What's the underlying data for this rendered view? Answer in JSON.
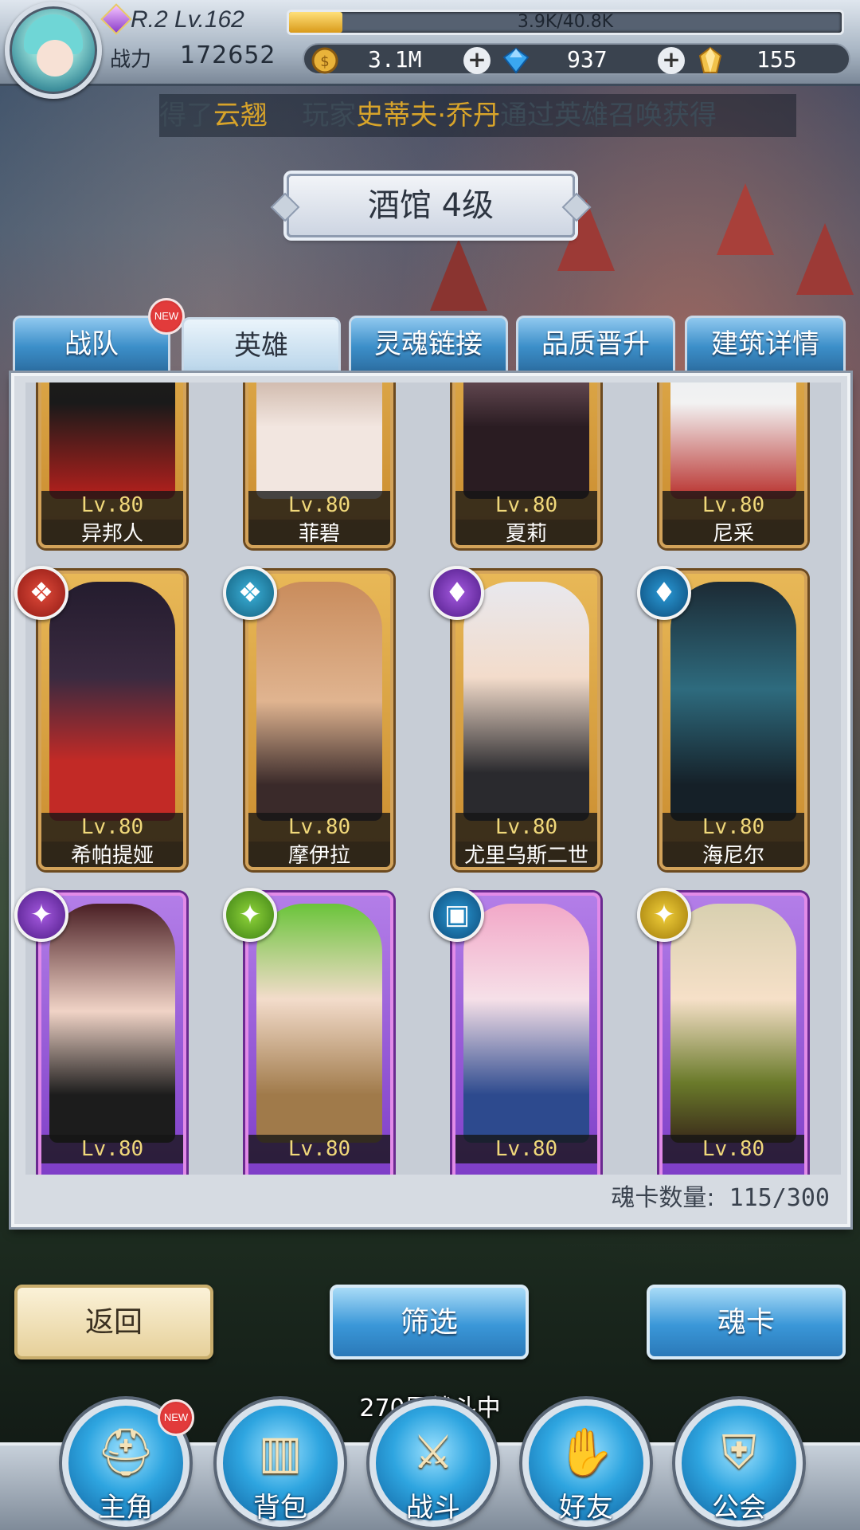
{
  "player": {
    "rank_level": "R.2 Lv.162",
    "exp_text": "3.9K/40.8K",
    "exp_fraction": 0.096,
    "power_label": "战力",
    "power_value": "172652"
  },
  "currencies": [
    {
      "icon": "gold-coin-icon",
      "value": "3.1M",
      "color": "#e9b33a"
    },
    {
      "icon": "blue-diamond-icon",
      "value": "937",
      "color": "#3aa7f0"
    },
    {
      "icon": "gold-crystal-icon",
      "value": "155",
      "color": "#f1c24a"
    }
  ],
  "marquee": {
    "part1": "得了",
    "part1_hl": "云翘",
    "part2": "玩家",
    "part2_hl": "史蒂夫·乔丹",
    "part3": "通过英雄召唤获得"
  },
  "title": "酒馆 4级",
  "tabs": [
    {
      "label": "战队",
      "active": false,
      "new": true
    },
    {
      "label": "英雄",
      "active": true,
      "new": false
    },
    {
      "label": "灵魂链接",
      "active": false,
      "new": false
    },
    {
      "label": "品质晋升",
      "active": false,
      "new": false
    },
    {
      "label": "建筑详情",
      "active": false,
      "new": false
    }
  ],
  "new_badge": "NEW",
  "heroes": [
    {
      "level": "Lv.80",
      "name": "异邦人",
      "frame": "gold"
    },
    {
      "level": "Lv.80",
      "name": "菲碧",
      "frame": "gold"
    },
    {
      "level": "Lv.80",
      "name": "夏莉",
      "frame": "gold"
    },
    {
      "level": "Lv.80",
      "name": "尼采",
      "frame": "gold"
    },
    {
      "level": "Lv.80",
      "name": "希帕提娅",
      "frame": "gold",
      "element": "red"
    },
    {
      "level": "Lv.80",
      "name": "摩伊拉",
      "frame": "gold",
      "element": "blue"
    },
    {
      "level": "Lv.80",
      "name": "尤里乌斯二世",
      "frame": "gold",
      "element": "purple"
    },
    {
      "level": "Lv.80",
      "name": "海尼尔",
      "frame": "gold",
      "element": "navy"
    },
    {
      "level": "Lv.80",
      "name": "",
      "frame": "purple",
      "element": "purple"
    },
    {
      "level": "Lv.80",
      "name": "",
      "frame": "purple",
      "element": "green"
    },
    {
      "level": "Lv.80",
      "name": "",
      "frame": "purple",
      "element": "navy"
    },
    {
      "level": "Lv.80",
      "name": "",
      "frame": "purple",
      "element": "gold"
    }
  ],
  "card_count": {
    "label": "魂卡数量:",
    "value": "115/300"
  },
  "buttons": {
    "back": "返回",
    "filter": "筛选",
    "soul_card": "魂卡"
  },
  "battle_status": "270层战斗中",
  "nav": [
    {
      "label": "主角",
      "icon": "knight-helmet-icon",
      "new": true
    },
    {
      "label": "背包",
      "icon": "backpack-icon",
      "new": false
    },
    {
      "label": "战斗",
      "icon": "crossed-swords-icon",
      "new": false
    },
    {
      "label": "好友",
      "icon": "handshake-icon",
      "new": false
    },
    {
      "label": "公会",
      "icon": "guild-crest-icon",
      "new": false
    }
  ]
}
